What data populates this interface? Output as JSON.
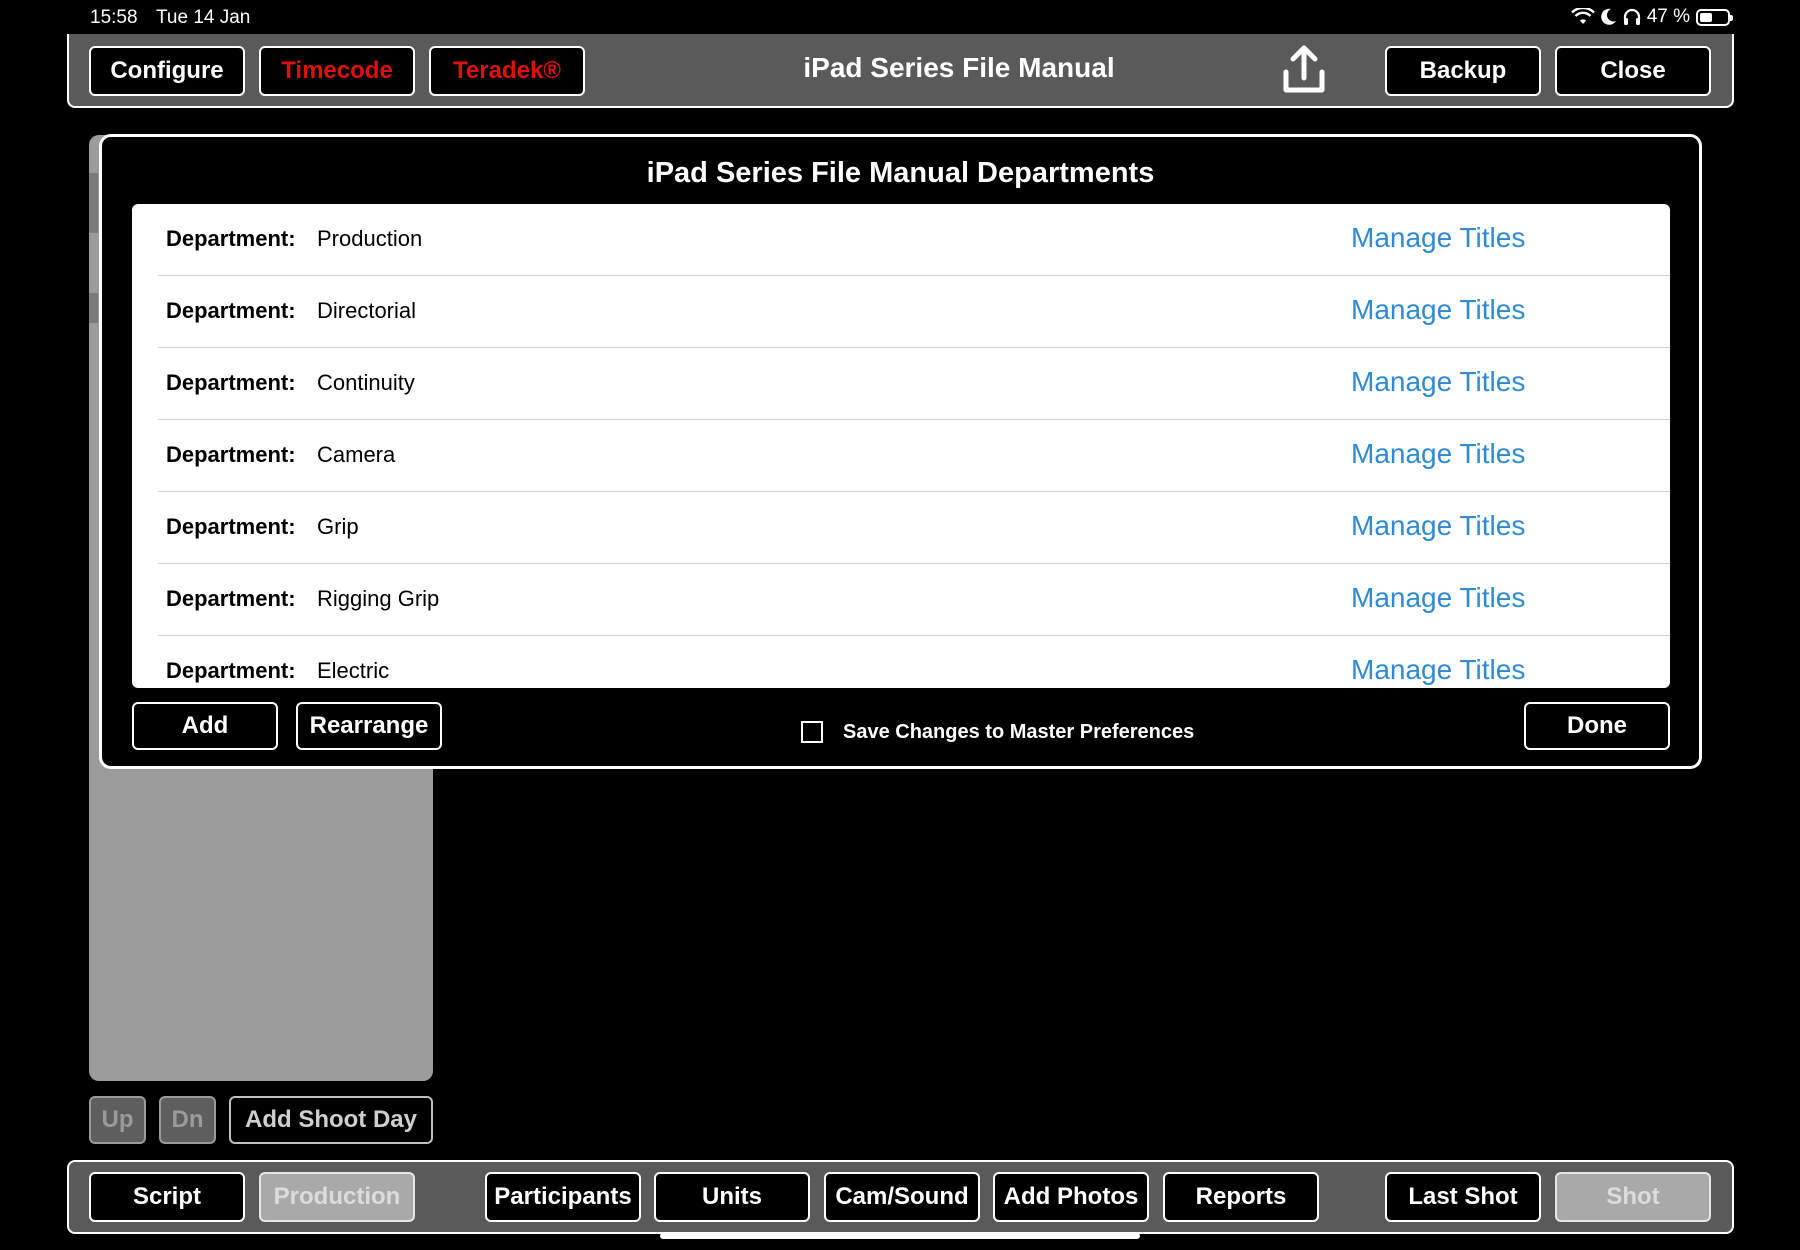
{
  "status": {
    "time": "15:58",
    "date": "Tue 14 Jan",
    "battery_pct": "47 %",
    "battery_level": 0.47
  },
  "top_bar": {
    "configure": "Configure",
    "timecode": "Timecode",
    "teradek": "Teradek®",
    "title": "iPad Series File Manual",
    "backup": "Backup",
    "close": "Close"
  },
  "modal": {
    "title": "iPad Series File Manual Departments",
    "department_label": "Department:",
    "manage_label": "Manage Titles",
    "departments": [
      "Production",
      "Directorial",
      "Continuity",
      "Camera",
      "Grip",
      "Rigging Grip",
      "Electric"
    ],
    "add": "Add",
    "rearrange": "Rearrange",
    "save_master": "Save Changes to Master Preferences",
    "done": "Done"
  },
  "left_controls": {
    "up": "Up",
    "dn": "Dn",
    "add_shoot_day": "Add Shoot Day"
  },
  "bottom_bar": {
    "script": "Script",
    "production": "Production",
    "participants": "Participants",
    "units": "Units",
    "cam_sound": "Cam/Sound",
    "add_photos": "Add Photos",
    "reports": "Reports",
    "last_shot": "Last Shot",
    "shot": "Shot"
  },
  "colors": {
    "accent_link": "#2f8ad3",
    "alert_red": "#e01010",
    "bar_gray": "#5a5a5a"
  }
}
